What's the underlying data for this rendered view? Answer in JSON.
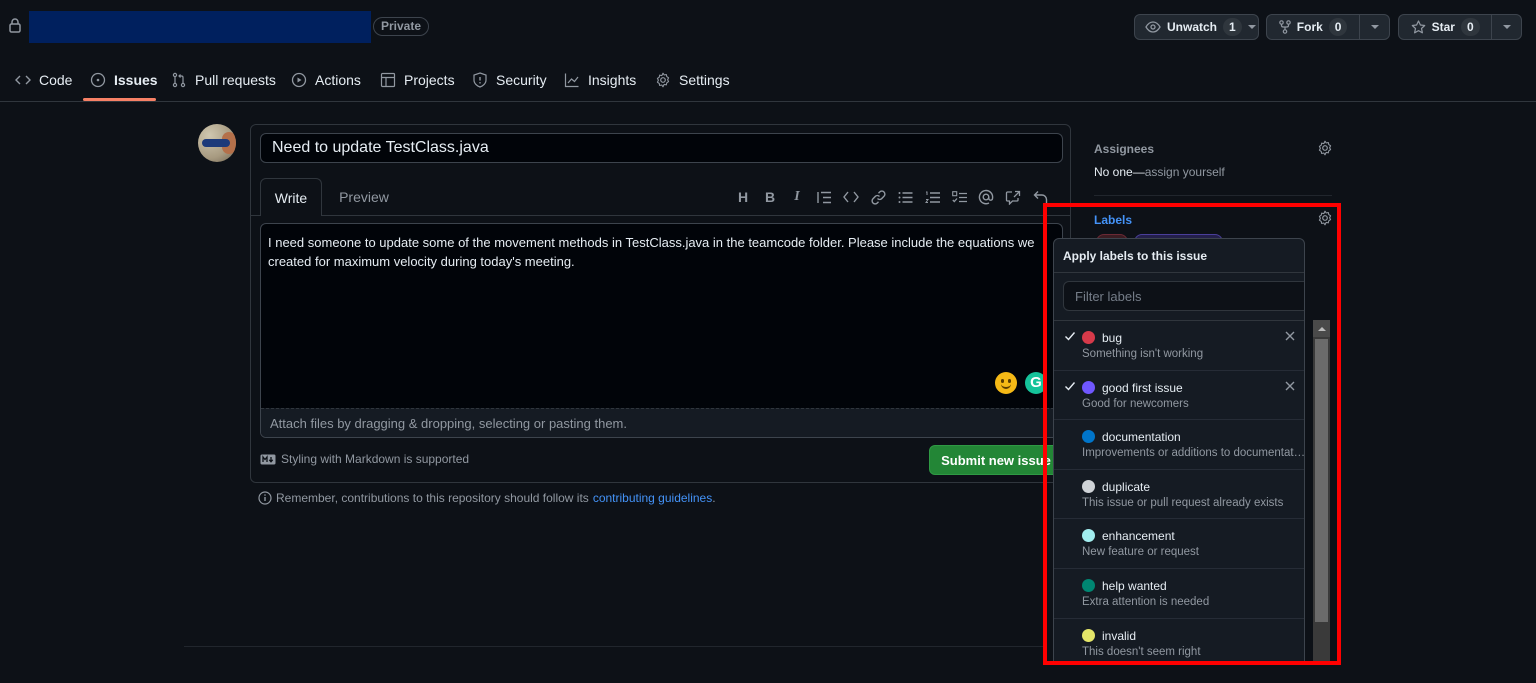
{
  "repo": {
    "visibility_badge": "Private",
    "actions": {
      "watch": {
        "label": "Unwatch",
        "count": "1"
      },
      "fork": {
        "label": "Fork",
        "count": "0"
      },
      "star": {
        "label": "Star",
        "count": "0"
      }
    }
  },
  "nav": {
    "tabs": [
      {
        "label": "Code",
        "icon": "code-icon"
      },
      {
        "label": "Issues",
        "icon": "issue-opened-icon",
        "active": true
      },
      {
        "label": "Pull requests",
        "icon": "git-pull-request-icon"
      },
      {
        "label": "Actions",
        "icon": "play-icon"
      },
      {
        "label": "Projects",
        "icon": "table-icon"
      },
      {
        "label": "Security",
        "icon": "shield-icon"
      },
      {
        "label": "Insights",
        "icon": "graph-icon"
      },
      {
        "label": "Settings",
        "icon": "gear-icon"
      }
    ]
  },
  "issue_form": {
    "title_value": "Need to update TestClass.java",
    "tabs": {
      "write": "Write",
      "preview": "Preview"
    },
    "toolbar": [
      "heading",
      "bold",
      "italic",
      "quote",
      "code",
      "link",
      "unordered-list",
      "ordered-list",
      "task-list",
      "mention",
      "reference",
      "undo"
    ],
    "body_value": "I need someone to update some of the movement methods in TestClass.java in the teamcode folder. Please include the equations we created for maximum velocity during today's meeting.",
    "attach_hint": "Attach files by dragging & dropping, selecting or pasting them.",
    "markdown_note": "Styling with Markdown is supported",
    "submit_label": "Submit new issue",
    "grammarly_label": "G",
    "guideline_text": "Remember, contributions to this repository should follow its",
    "guideline_link": "contributing guidelines",
    "guideline_end": "."
  },
  "sidebar": {
    "assignees": {
      "title": "Assignees",
      "value_prefix": "No one—",
      "value_link": "assign yourself"
    },
    "labels": {
      "title": "Labels",
      "title_color": "#4493f8"
    }
  },
  "labels_popup": {
    "header": "Apply labels to this issue",
    "filter_placeholder": "Filter labels",
    "items": [
      {
        "name": "bug",
        "description": "Something isn't working",
        "color": "#d73a4a",
        "selected": true
      },
      {
        "name": "good first issue",
        "description": "Good for newcomers",
        "color": "#7057ff",
        "selected": true
      },
      {
        "name": "documentation",
        "description": "Improvements or additions to documentation",
        "color": "#0075ca",
        "selected": false
      },
      {
        "name": "duplicate",
        "description": "This issue or pull request already exists",
        "color": "#cfd3d7",
        "selected": false
      },
      {
        "name": "enhancement",
        "description": "New feature or request",
        "color": "#a2eeef",
        "selected": false
      },
      {
        "name": "help wanted",
        "description": "Extra attention is needed",
        "color": "#008672",
        "selected": false
      },
      {
        "name": "invalid",
        "description": "This doesn't seem right",
        "color": "#e4e669",
        "selected": false
      }
    ]
  },
  "annotation": {
    "highlight_color": "#ff0000"
  }
}
